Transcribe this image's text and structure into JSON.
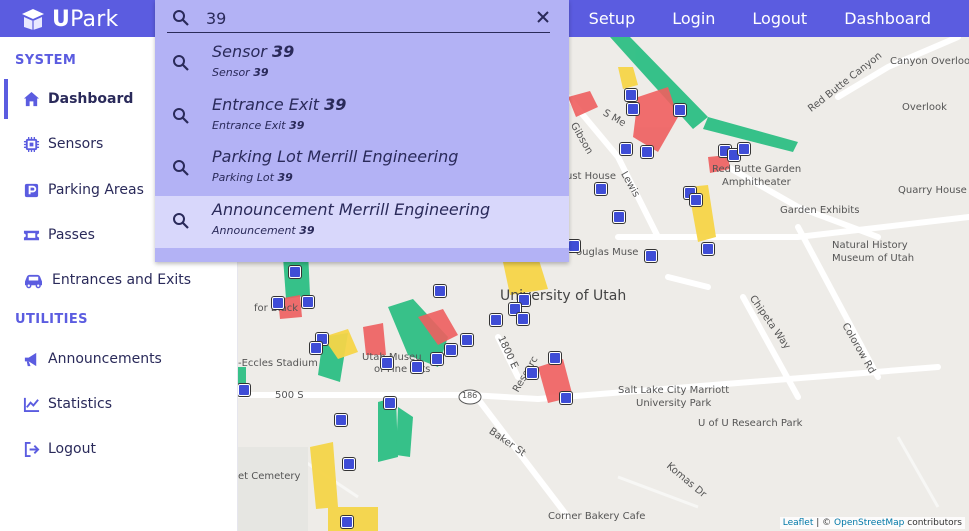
{
  "brand": {
    "prefix": "U",
    "rest": "Park"
  },
  "nav": {
    "setup": "Setup",
    "login": "Login",
    "logout": "Logout",
    "dashboard": "Dashboard"
  },
  "search": {
    "value": "39",
    "results": [
      {
        "title": "Sensor",
        "title_match": "39",
        "sub": "Sensor",
        "sub_match": "39"
      },
      {
        "title": "Entrance Exit",
        "title_match": "39",
        "sub": "Entrance Exit",
        "sub_match": "39"
      },
      {
        "title": "Parking Lot Merrill Engineering",
        "title_match": "",
        "sub": "Parking Lot",
        "sub_match": "39"
      },
      {
        "title": "Announcement Merrill Engineering",
        "title_match": "",
        "sub": "Announcement",
        "sub_match": "39"
      }
    ]
  },
  "sidebar": {
    "system_title": "SYSTEM",
    "utilities_title": "UTILITIES",
    "items": [
      {
        "label": "Dashboard",
        "icon": "home-icon"
      },
      {
        "label": "Sensors",
        "icon": "chip-icon"
      },
      {
        "label": "Parking Areas",
        "icon": "parking-icon"
      },
      {
        "label": "Passes",
        "icon": "ticket-icon"
      },
      {
        "label": "Entrances and Exits",
        "icon": "car-icon"
      },
      {
        "label": "Announcements",
        "icon": "megaphone-icon"
      },
      {
        "label": "Statistics",
        "icon": "chart-line-icon"
      },
      {
        "label": "Logout",
        "icon": "sign-out-icon"
      }
    ]
  },
  "map": {
    "labels": {
      "canyon_overlook": "Canyon Overlook",
      "overlook": "Overlook",
      "red_butte_canyon": "Red Butte Canyon",
      "red_butte_garden": "Red Butte Garden",
      "amphitheater": "Amphitheater",
      "quarry_house": "Quarry House",
      "garden_exhibits": "Garden Exhibits",
      "natural_history": "Natural History",
      "museum_of_utah": "Museum of Utah",
      "s_me": "S Me",
      "gibson": "Gibson",
      "lewis": "Lewis",
      "ust_house": "ust House",
      "ouglas_muse": "ouglas Muse",
      "university_of_utah": "University of Utah",
      "chipeta_way": "Chipeta Way",
      "colorow_rd": "Colorow Rd",
      "utah_museum": "Utah Museu",
      "of_fine_arts": "of Fine Arts",
      "eccles_stadium": "-Eccles Stadium",
      "for_black": "for Black",
      "s1800e": "1800 E",
      "research": "Researc",
      "five_hundred_s": "500 S",
      "route_186": "186",
      "baker_st": "Baker St",
      "marriott_1": "Salt Lake City Marriott",
      "marriott_2": "University Park",
      "u_research_park": "U of U Research Park",
      "komas_dr": "Komas Dr",
      "et_cemetery": "et Cemetery",
      "corner_bakery": "Corner Bakery Cafe"
    },
    "attribution": {
      "leaflet": "Leaflet",
      "sep": " | © ",
      "osm": "OpenStreetMap",
      "contributors": " contributors"
    }
  },
  "colors": {
    "accent": "#5b5ce0",
    "lot_red": "#ef5f5f",
    "lot_yellow": "#f5d548",
    "lot_green": "#2dbf84",
    "marker": "#3f4dd6"
  }
}
